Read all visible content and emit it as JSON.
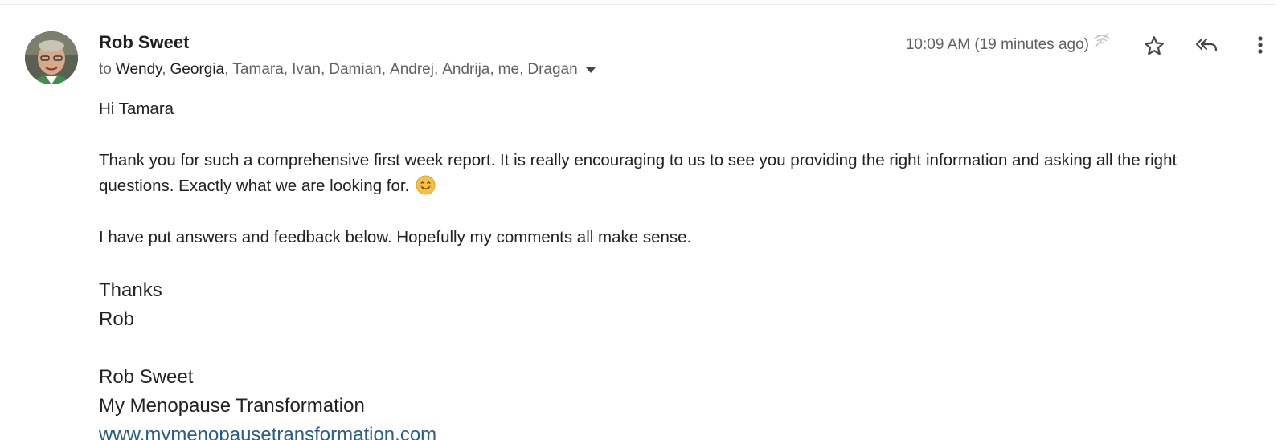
{
  "email": {
    "sender_name": "Rob Sweet",
    "to_label": "to",
    "recipients": [
      {
        "name": "Wendy",
        "emphasis": true
      },
      {
        "name": "Georgia",
        "emphasis": true
      },
      {
        "name": "Tamara",
        "emphasis": false
      },
      {
        "name": "Ivan",
        "emphasis": false
      },
      {
        "name": "Damian",
        "emphasis": false
      },
      {
        "name": "Andrej",
        "emphasis": false
      },
      {
        "name": "Andrija",
        "emphasis": false
      },
      {
        "name": "me",
        "emphasis": false
      },
      {
        "name": "Dragan",
        "emphasis": false
      }
    ],
    "timestamp": "10:09 AM (19 minutes ago)",
    "icons": {
      "star": "star-icon",
      "reply_all": "reply-all-icon",
      "more": "more-vertical-icon",
      "status": "wifi-off-icon",
      "details_caret": "chevron-down-icon",
      "emoji": "smiling-face-icon"
    },
    "body": {
      "greeting": "Hi Tamara",
      "paragraph1": "Thank you for such a comprehensive first week report. It is really encouraging to us to see you providing the right information and asking all the right questions.  Exactly what we are looking for.",
      "paragraph2": "I have put answers and feedback below. Hopefully my comments all make sense.",
      "signoff": "Thanks",
      "signoff_name": "Rob",
      "signature_name": "Rob Sweet",
      "signature_company": "My Menopause Transformation",
      "signature_link": "www.mymenopausetransformation.com"
    }
  },
  "colors": {
    "link": "#2b5d8a",
    "secondary_text": "#5f6368",
    "primary_text": "#1f1f1f"
  }
}
